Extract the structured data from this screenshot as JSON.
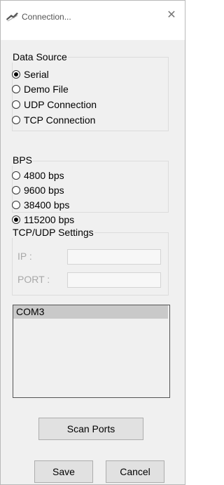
{
  "window": {
    "title": "Connection...",
    "close_symbol": "✕"
  },
  "data_source": {
    "label": "Data Source",
    "options": [
      {
        "label": "Serial",
        "checked": true
      },
      {
        "label": "Demo File",
        "checked": false
      },
      {
        "label": "UDP Connection",
        "checked": false
      },
      {
        "label": "TCP Connection",
        "checked": false
      }
    ]
  },
  "bps": {
    "label": "BPS",
    "options": [
      {
        "label": "4800 bps",
        "checked": false
      },
      {
        "label": "9600 bps",
        "checked": false
      },
      {
        "label": "38400 bps",
        "checked": false
      },
      {
        "label": "115200 bps",
        "checked": true
      }
    ]
  },
  "tcp_udp": {
    "label": "TCP/UDP Settings",
    "ip_label": "IP :",
    "port_label": "PORT :",
    "ip_value": "",
    "port_value": ""
  },
  "ports": {
    "items": [
      "COM3"
    ],
    "selected_index": 0
  },
  "buttons": {
    "scan": "Scan Ports",
    "save": "Save",
    "cancel": "Cancel"
  }
}
